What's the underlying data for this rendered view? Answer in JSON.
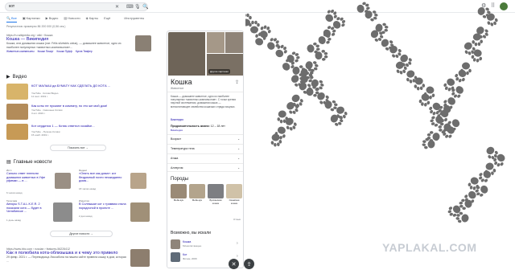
{
  "search": {
    "query": "кот",
    "tabs": [
      "Все",
      "Картинки",
      "Видео",
      "Новости",
      "Карты",
      "Ещё",
      "Инструменты"
    ]
  },
  "stats": "Результатов: примерно 86 200 000 (0,56 сек.)",
  "wiki": {
    "url": "https://ru.wikipedia.org › wiki › Кошка",
    "title": "Кошка — Википедия",
    "snippet": "Кошка, или домашняя кошка (лат. Félis silvéstris cátus), — домашнее животное, одно из наиболее популярных «животных-компаньонов»...",
    "links": [
      "Животные-компаньоны",
      "Кошки Пишут",
      "Кошки Пуфф",
      "Кукла Твифер"
    ]
  },
  "videos": {
    "heading": "Видео",
    "items": [
      {
        "title": "КОТ МАЛЫШ да БУМАГУ КАК СДЕЛАТЬ ДО КОТА ...",
        "src": "YouTube · Котики Видео",
        "date": "11 сент. 2019 г."
      },
      {
        "title": "Как коты не пускают в комнату, но это же мой дом!",
        "src": "YouTube · Смешные Котики",
        "date": "3 окт. 2019 г."
      },
      {
        "title": "Кот сердится 1 — Котик ответил хозяйке...",
        "src": "YouTube · Лучшие Котики",
        "date": "15 нояб. 2019 г."
      }
    ],
    "more": "Показать все"
  },
  "news": {
    "heading": "Главные новости",
    "items": [
      {
        "src": "ИА 1",
        "title": "Сильно ответ пленили домашних животных в Уфе уфимки — в ...",
        "time": "6 часов назад"
      },
      {
        "src": "Яндекс",
        "title": "«Опять все как дома»: кот бездомный почти неожиданно дома...",
        "time": "18 часов назад"
      },
      {
        "src": "Телеграм",
        "title": "Авторы S.T.A.L.K.E.R. 2 показали кота — будет в Челябинске ...",
        "time": "1 день назад"
      },
      {
        "src": "Известия",
        "title": "В Солнышке кот с трамвая стала порядочной в проекте ...",
        "time": "2 дня назад"
      }
    ],
    "more": "Другие новости"
  },
  "result2": {
    "url": "https://www.bbc.com › russian › features-56226412",
    "title": "Как я полюбила кота-облизышка и к чему это привело",
    "snippet": "29 февр. 2021 г. — Переводчица Лиссабона на нашем сайте привела кошку в дом, которая ..."
  },
  "panel": {
    "title": "Кошка",
    "subtitle": "Животное",
    "photo_label": "Другие картинки",
    "desc": "Кошка — домашнее животное, одно из наиболее популярных «животных-компаньонов». С точки зрения научной систематики, домашняя кошка — млекопитающее семейства кошачьих отряда хищных.",
    "source": "Википедия",
    "lifespan_label": "Продолжительность жизни:",
    "lifespan_value": "12 – 18 лет",
    "lifespan_src": "Википедия",
    "rows": [
      "Возраст",
      "Температура тела",
      "Атака",
      "Аллергия"
    ],
    "breeds_heading": "Породы",
    "breeds": [
      "Мейн-кун",
      "Мейн-кун",
      "Британская кошка",
      "Сиамская кошка"
    ],
    "more_label": "Отзыв",
    "also_heading": "Возможно, вы искали",
    "also": [
      {
        "name": "Кошка",
        "desc": "Млекопитающее"
      },
      {
        "name": "Кот",
        "desc": "Фильм, 2009"
      }
    ]
  },
  "watermark": "YAPLAKAL.COM",
  "colors": {
    "link": "#1a0dab",
    "accent": "#1a73e8",
    "paw": "#6d6d6d"
  }
}
